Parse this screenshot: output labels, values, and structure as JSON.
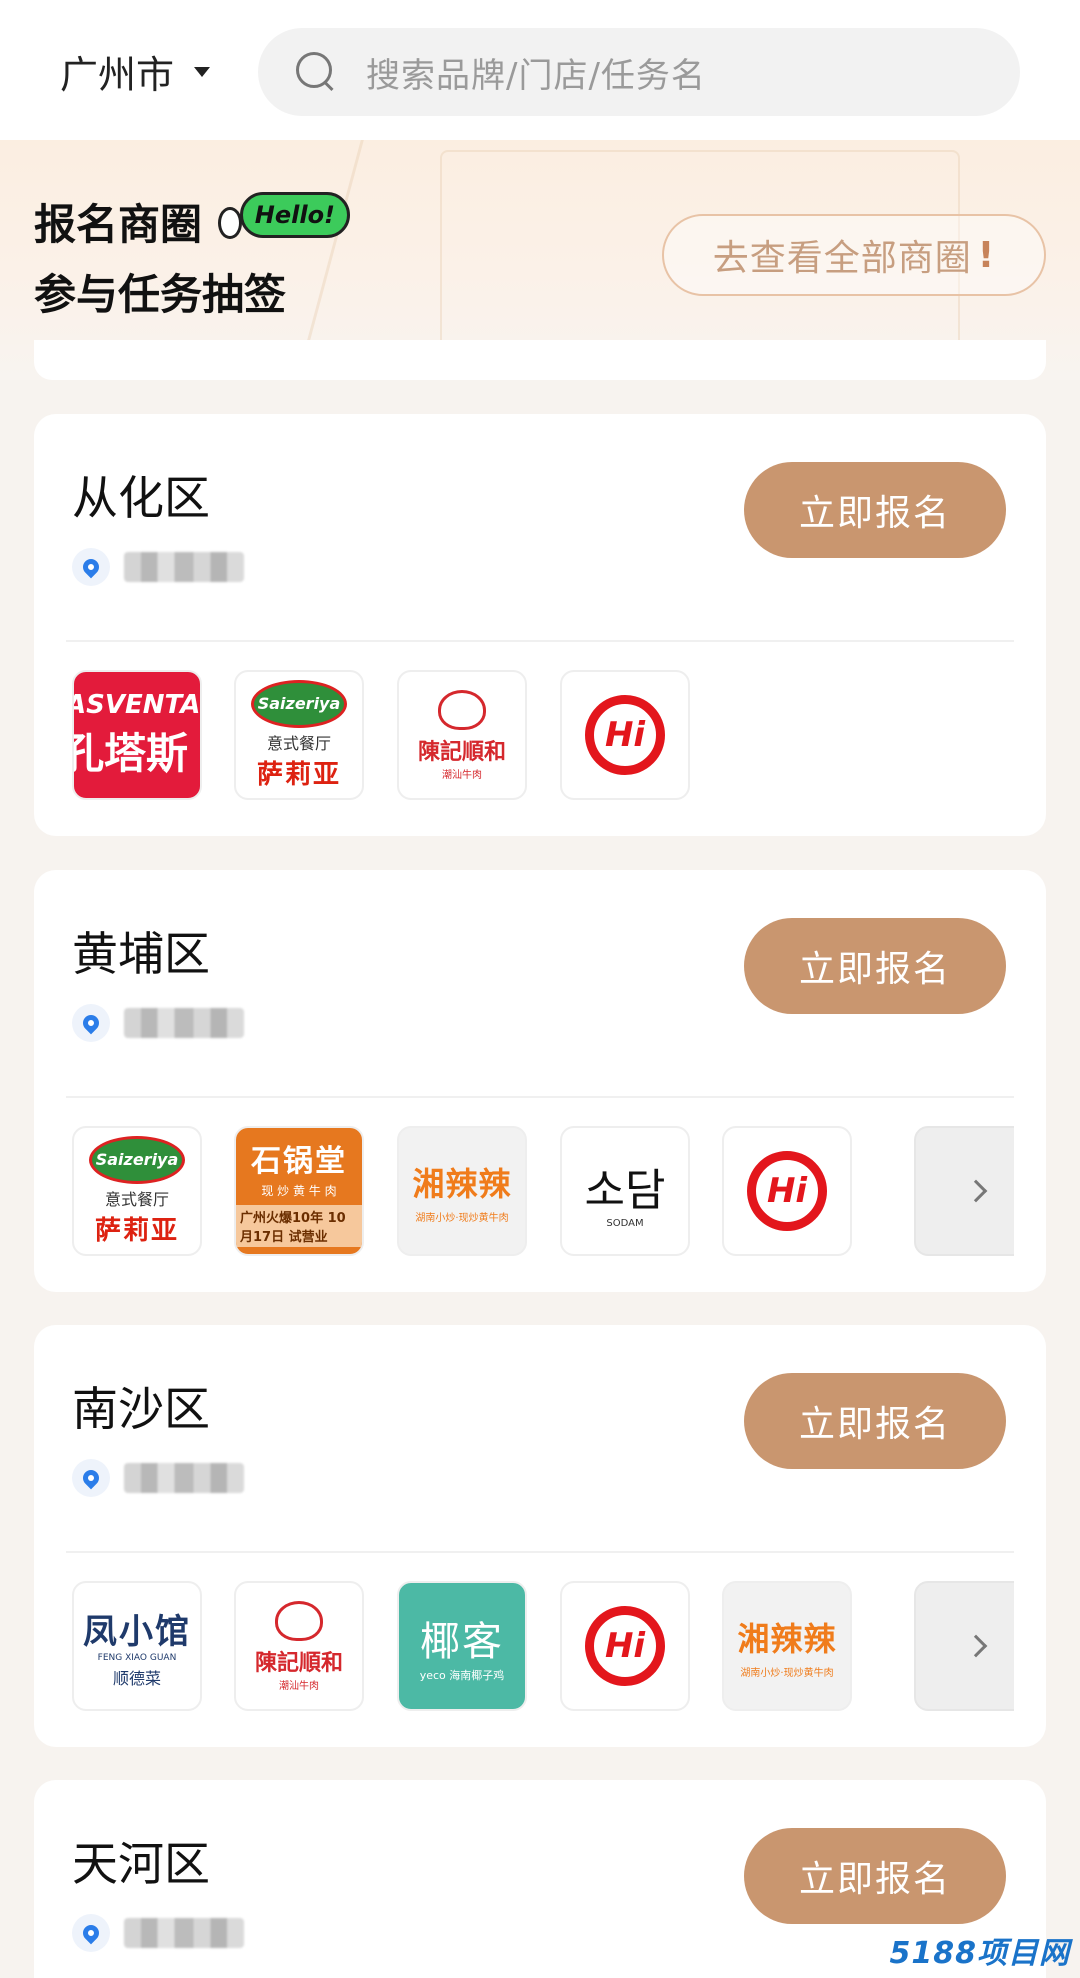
{
  "header": {
    "city": "广州市",
    "search_placeholder": "搜索品牌/门店/任务名"
  },
  "hero": {
    "title_line1": "报名商圈",
    "title_line2": "参与任务抽签",
    "hello_badge": "Hello!",
    "view_all_label": "去查看全部商圈",
    "view_all_mark": "!"
  },
  "signup_label": "立即报名",
  "cards": [
    {
      "district": "从化区",
      "logos": [
        {
          "brand": "Las Venta",
          "text_a": "ASVENTA",
          "text_b": "孔塔斯"
        },
        {
          "brand": "Saizeriya",
          "badge": "Saizeriya",
          "sub": "意式餐厅",
          "name": "萨莉亚"
        },
        {
          "brand": "陈记顺和",
          "name": "陳記順和",
          "sub": "潮汕牛肉"
        },
        {
          "brand": "Hi",
          "text": "Hi"
        }
      ]
    },
    {
      "district": "黄埔区",
      "logos": [
        {
          "brand": "Saizeriya",
          "badge": "Saizeriya",
          "sub": "意式餐厅",
          "name": "萨莉亚"
        },
        {
          "brand": "石锅堂",
          "name": "石锅堂",
          "mid": "现 炒 黄 牛 肉",
          "sub": "广州火爆10年 10月17日 试营业"
        },
        {
          "brand": "湘辣辣",
          "name": "湘辣辣",
          "sub": "湖南小炒·现炒黄牛肉"
        },
        {
          "brand": "SODAM",
          "name": "소담",
          "sub": "SODAM"
        },
        {
          "brand": "Hi",
          "text": "Hi"
        }
      ],
      "has_more": true
    },
    {
      "district": "南沙区",
      "logos": [
        {
          "brand": "凤小馆",
          "name": "凤小馆",
          "pinyin": "FENG XIAO GUAN",
          "sub": "顺德菜"
        },
        {
          "brand": "陈记顺和",
          "name": "陳記順和",
          "sub": "潮汕牛肉"
        },
        {
          "brand": "椰客",
          "name": "椰客",
          "sub": "yeco 海南椰子鸡"
        },
        {
          "brand": "Hi",
          "text": "Hi"
        },
        {
          "brand": "湘辣辣",
          "name": "湘辣辣",
          "sub": "湖南小炒·现炒黄牛肉"
        }
      ],
      "has_more": true
    },
    {
      "district": "天河区",
      "logos": []
    }
  ],
  "watermark": "5188项目网",
  "colors": {
    "signup_button": "#c9966f",
    "pin": "#2b7de9",
    "view_all_border": "#e8c3a6"
  }
}
